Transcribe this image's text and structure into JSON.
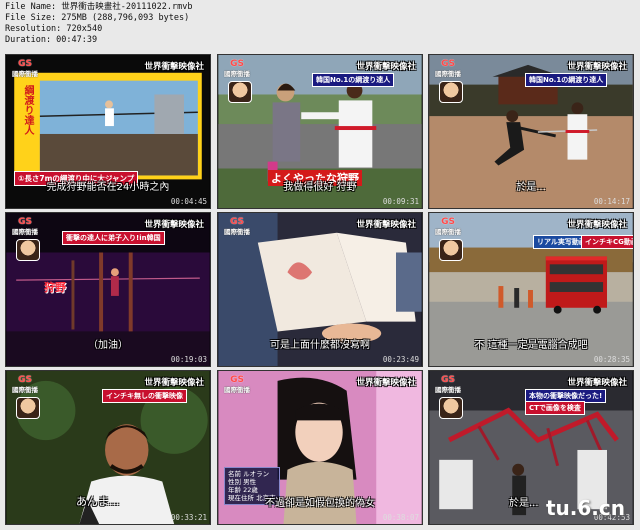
{
  "file_info": {
    "name_line": "File Name: 世界衝击映畫社-20111022.rmvb",
    "size_line": "File Size: 275MB (288,796,093 bytes)",
    "resolution_line": "Resolution: 720x540",
    "duration_line": "Duration: 00:47:39"
  },
  "common": {
    "gs_label": "GS",
    "gs_sub": "國際衝播",
    "tv_logo": "世界衝擊映像社"
  },
  "thumbnails": [
    {
      "timestamp": "00:04:45",
      "caption": "完成狩野能否在24小時之內",
      "overlay_vertical": "綱渡り達人",
      "overlay_banner": "①長さ7mの綱渡り中に大ジャンプ"
    },
    {
      "timestamp": "00:09:31",
      "caption": "我做得很好  狩野",
      "overlay_banner": "よくやったな狩野",
      "overlay_top": "韓国No.1の綱渡り達人"
    },
    {
      "timestamp": "00:14:17",
      "caption": "於是...",
      "overlay_top": "韓国No.1の綱渡り達人"
    },
    {
      "timestamp": "00:19:03",
      "caption": "（加油）",
      "overlay_name": "狩野",
      "overlay_top": "衝撃の達人に弟子入り!in韓国"
    },
    {
      "timestamp": "00:23:49",
      "caption": "可是上面什麼都沒寫啊"
    },
    {
      "timestamp": "00:28:35",
      "caption": "不 這種一定是電腦合成吧",
      "overlay_top": "リアル実写動画",
      "overlay_top2": "インチキCG動画"
    },
    {
      "timestamp": "00:33:21",
      "caption": "あんま...",
      "overlay_top": "インチキ無しの衝撃映像"
    },
    {
      "timestamp": "00:38:07",
      "caption": "不過卻是如假包換的偽女",
      "overlay_info": [
        "名前 ルオラン",
        "性別 男性",
        "年齢 22歳",
        "現在住所 北京市"
      ]
    },
    {
      "timestamp": "00:42:53",
      "caption": "於是...",
      "overlay_top": "本物の衝撃映像だった!",
      "overlay_top2": "CTで画像を検査"
    }
  ],
  "watermark": "tu.6.cn",
  "colors": {
    "background": "#e9e9e9",
    "accent_red": "#c8102e",
    "caption_text": "#ffffff"
  }
}
